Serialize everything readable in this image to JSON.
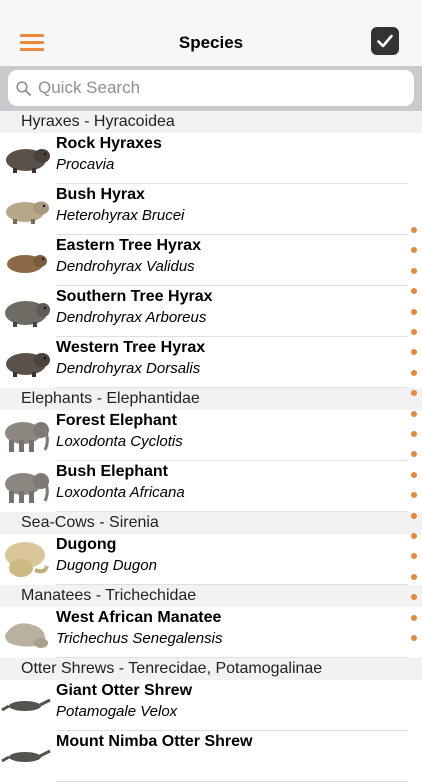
{
  "nav": {
    "title": "Species",
    "menu_icon": "hamburger-icon",
    "done_icon": "checkmark-icon"
  },
  "search": {
    "placeholder": "Quick Search"
  },
  "colors": {
    "accent": "#e8883a",
    "header_bg": "#f2f2f2",
    "search_bar_bg": "#c9c9ce"
  },
  "sections": [
    {
      "title": "Hyraxes - Hyracoidea",
      "items": [
        {
          "name": "Rock Hyraxes",
          "latin": "Procavia"
        },
        {
          "name": "Bush Hyrax",
          "latin": "Heterohyrax Brucei"
        },
        {
          "name": "Eastern Tree Hyrax",
          "latin": "Dendrohyrax Validus"
        },
        {
          "name": "Southern Tree Hyrax",
          "latin": "Dendrohyrax Arboreus"
        },
        {
          "name": "Western Tree Hyrax",
          "latin": "Dendrohyrax Dorsalis"
        }
      ]
    },
    {
      "title": "Elephants - Elephantidae",
      "items": [
        {
          "name": "Forest Elephant",
          "latin": "Loxodonta Cyclotis"
        },
        {
          "name": "Bush Elephant",
          "latin": "Loxodonta Africana"
        }
      ]
    },
    {
      "title": "Sea-Cows - Sirenia",
      "items": [
        {
          "name": "Dugong",
          "latin": "Dugong Dugon"
        }
      ]
    },
    {
      "title": "Manatees - Trichechidae",
      "items": [
        {
          "name": "West African Manatee",
          "latin": "Trichechus Senegalensis"
        }
      ]
    },
    {
      "title": "Otter Shrews - Tenrecidae, Potamogalinae",
      "items": [
        {
          "name": "Giant Otter Shrew",
          "latin": "Potamogale Velox"
        },
        {
          "name": "Mount Nimba Otter Shrew",
          "latin": ""
        }
      ]
    }
  ],
  "index_dot_count": 21
}
